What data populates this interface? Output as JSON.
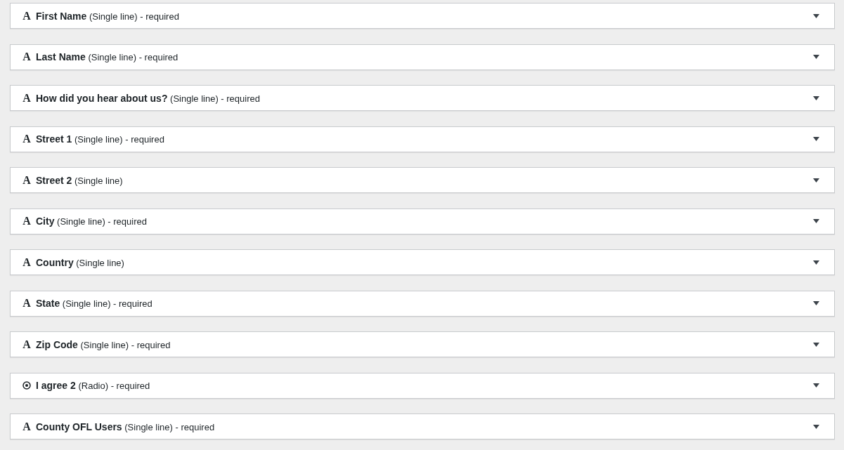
{
  "fields": [
    {
      "kind": "text",
      "icon_glyph": "A",
      "title": "**First Name** (Single line) - required",
      "expanded": false
    },
    {
      "kind": "text",
      "icon_glyph": "A",
      "title": "**Last Name** (Single line) - required",
      "expanded": false
    },
    {
      "kind": "text",
      "icon_glyph": "A",
      "title": "**How did you hear about us?** (Single line) - required",
      "expanded": false
    },
    {
      "kind": "text",
      "icon_glyph": "A",
      "title": "**Street 1** (Single line) - required",
      "expanded": false
    },
    {
      "kind": "text",
      "icon_glyph": "A",
      "title": "**Street 2** (Single line)",
      "expanded": false
    },
    {
      "kind": "text",
      "icon_glyph": "A",
      "title": "**City** (Single line) - required",
      "expanded": false
    },
    {
      "kind": "text",
      "icon_glyph": "A",
      "title": "**Country** (Single line)",
      "expanded": false
    },
    {
      "kind": "text",
      "icon_glyph": "A",
      "title": "**State** (Single line) - required",
      "expanded": false
    },
    {
      "kind": "text",
      "icon_glyph": "A",
      "title": "**Zip Code** (Single line) - required",
      "expanded": false
    },
    {
      "kind": "radio",
      "title": "**I agree 2** (Radio) - required",
      "expanded": false
    },
    {
      "kind": "text",
      "icon_glyph": "A",
      "title": "**County OFL Users** (Single line) - required",
      "expanded": false
    }
  ]
}
